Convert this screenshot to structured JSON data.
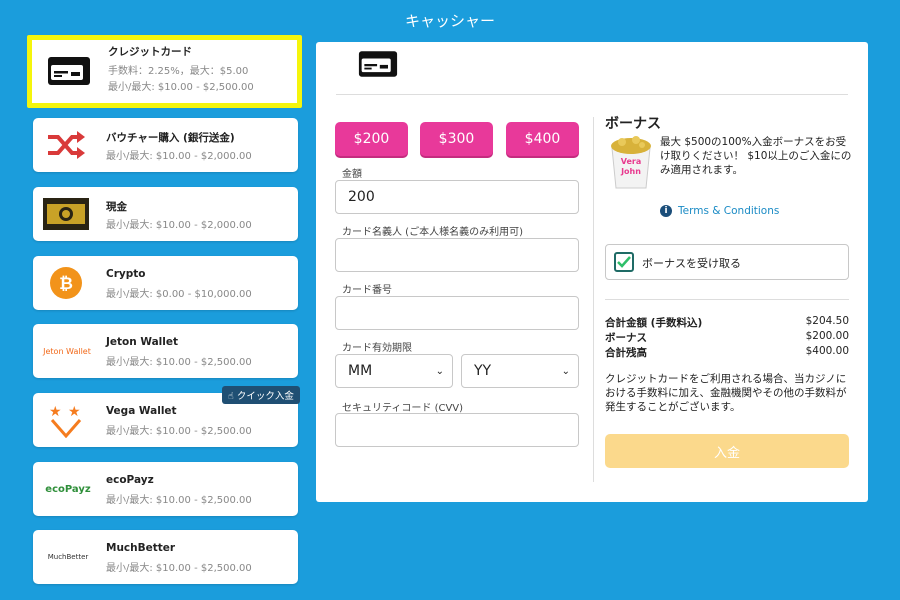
{
  "page_title": "キャッシャー",
  "methods": [
    {
      "name": "クレジットカード",
      "fee": "手数料：2.25%，最大：$5.00",
      "limits": "最小/最大: $10.00 - $2,500.00",
      "icon": "credit-card-icon"
    },
    {
      "name": "バウチャー購入 (銀行送金)",
      "limits": "最小/最大: $10.00 - $2,000.00",
      "icon": "shuffle-icon"
    },
    {
      "name": "現金",
      "limits": "最小/最大: $10.00 - $2,000.00",
      "icon": "cash-icon"
    },
    {
      "name": "Crypto",
      "limits": "最小/最大: $0.00 - $10,000.00",
      "icon": "bitcoin-icon"
    },
    {
      "name": "Jeton Wallet",
      "limits": "最小/最大: $10.00 - $2,500.00",
      "icon": "jeton-logo",
      "logo_text": "Jeton Wallet"
    },
    {
      "name": "Vega Wallet",
      "limits": "最小/最大: $10.00 - $2,500.00",
      "icon": "vega-stars-icon"
    },
    {
      "name": "ecoPayz",
      "limits": "最小/最大: $10.00 - $2,500.00",
      "icon": "ecopayz-logo",
      "logo_text": "ecoPayz"
    },
    {
      "name": "MuchBetter",
      "limits": "最小/最大: $10.00 - $2,500.00",
      "icon": "muchbetter-logo",
      "logo_text": "MuchBetter"
    }
  ],
  "quick_deposit_badge": "クイック入金",
  "amount_buttons": [
    "$200",
    "$300",
    "$400"
  ],
  "form": {
    "amount_label": "金額",
    "amount_value": "200",
    "cardholder_label": "カード名義人 (ご本人様名義のみ利用可)",
    "card_number_label": "カード番号",
    "expiry_label": "カード有効期限",
    "month_value": "MM",
    "year_value": "YY",
    "cvv_label": "セキュリティコード (CVV)"
  },
  "bonus": {
    "title": "ボーナス",
    "description": "最大 $500の100%入金ボーナスをお受け取りください！ $10以上のご入金にのみ適用されます。",
    "image_text": "Vera John",
    "terms_label": "Terms & Conditions",
    "checkbox_label": "ボーナスを受け取る",
    "checked": true
  },
  "summary": [
    {
      "label": "合計金額 (手数料込)",
      "value": "$204.50"
    },
    {
      "label": "ボーナス",
      "value": "$200.00"
    },
    {
      "label": "合計残高",
      "value": "$400.00"
    }
  ],
  "note": "クレジットカードをご利用される場合、当カジノにおける手数料に加え、金融機関やその他の手数料が発生することがございます。",
  "deposit_button": "入金",
  "colors": {
    "background": "#1b9ddc",
    "amount_button": "#e8399a",
    "selected_border": "#f5f50c",
    "deposit_button": "#fbd98c"
  }
}
